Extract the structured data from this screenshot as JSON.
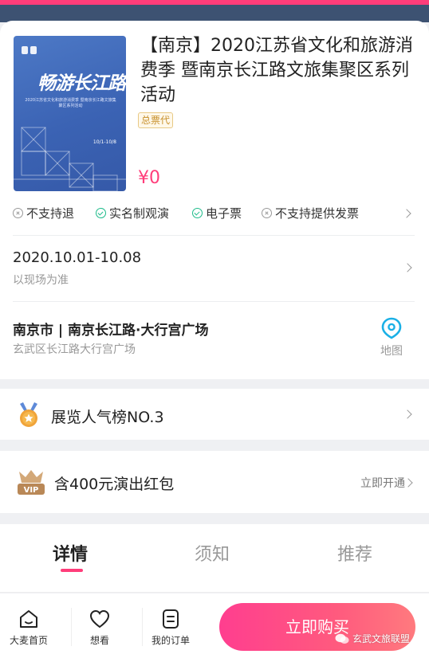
{
  "event": {
    "poster": {
      "title": "畅游长江路",
      "subtitle": "2020江苏省文化和旅游消费季 暨南京长江路文旅集聚区系列活动",
      "dates": "10/1-10/8"
    },
    "title": "【南京】2020江苏省文化和旅游消费季 暨南京长江路文旅集聚区系列活动",
    "agent_tag": "总票代",
    "price": "¥0"
  },
  "services": [
    {
      "icon": "no-icon",
      "label": "不支持退"
    },
    {
      "icon": "check-icon",
      "label": "实名制观演"
    },
    {
      "icon": "check-icon",
      "label": "电子票"
    },
    {
      "icon": "no-icon",
      "label": "不支持提供发票"
    }
  ],
  "date": {
    "range": "2020.10.01-10.08",
    "note": "以现场为准"
  },
  "venue": {
    "name": "南京市 | 南京长江路·大行宫广场",
    "address": "玄武区长江路大行宫广场",
    "map_label": "地图"
  },
  "ranking": {
    "label": "展览人气榜NO.3"
  },
  "vip": {
    "label": "含400元演出红包",
    "action": "立即开通"
  },
  "tabs": [
    {
      "label": "详情",
      "active": true
    },
    {
      "label": "须知",
      "active": false
    },
    {
      "label": "推荐",
      "active": false
    }
  ],
  "bottom_nav": [
    {
      "icon": "home-icon",
      "label": "大麦首页"
    },
    {
      "icon": "heart-icon",
      "label": "想看"
    },
    {
      "icon": "orders-icon",
      "label": "我的订单"
    }
  ],
  "buy_button": "立即购买",
  "watermark": "玄武文旅联盟",
  "colors": {
    "accent": "#ff3d7a",
    "check": "#1dbb8a",
    "map": "#1ab0e6",
    "medal": "#f0a43a",
    "vip": "#c9986a"
  }
}
